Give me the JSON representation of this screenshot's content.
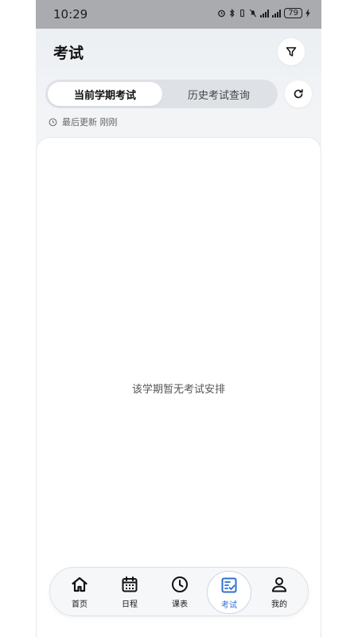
{
  "status_bar": {
    "time": "10:29",
    "battery": "79"
  },
  "header": {
    "title": "考试"
  },
  "tabs": [
    {
      "label": "当前学期考试",
      "active": true
    },
    {
      "label": "历史考试查询",
      "active": false
    }
  ],
  "updated": {
    "label": "最后更新 刚刚"
  },
  "empty_state": {
    "message": "该学期暂无考试安排"
  },
  "bottom_nav": {
    "items": [
      {
        "label": "首页",
        "icon": "home-icon",
        "active": false
      },
      {
        "label": "日程",
        "icon": "calendar-icon",
        "active": false
      },
      {
        "label": "课表",
        "icon": "clock-icon",
        "active": false
      },
      {
        "label": "考试",
        "icon": "exam-icon",
        "active": true
      },
      {
        "label": "我的",
        "icon": "person-icon",
        "active": false
      }
    ]
  },
  "colors": {
    "accent": "#2f6fcf",
    "status_bar": "#a9abae"
  }
}
